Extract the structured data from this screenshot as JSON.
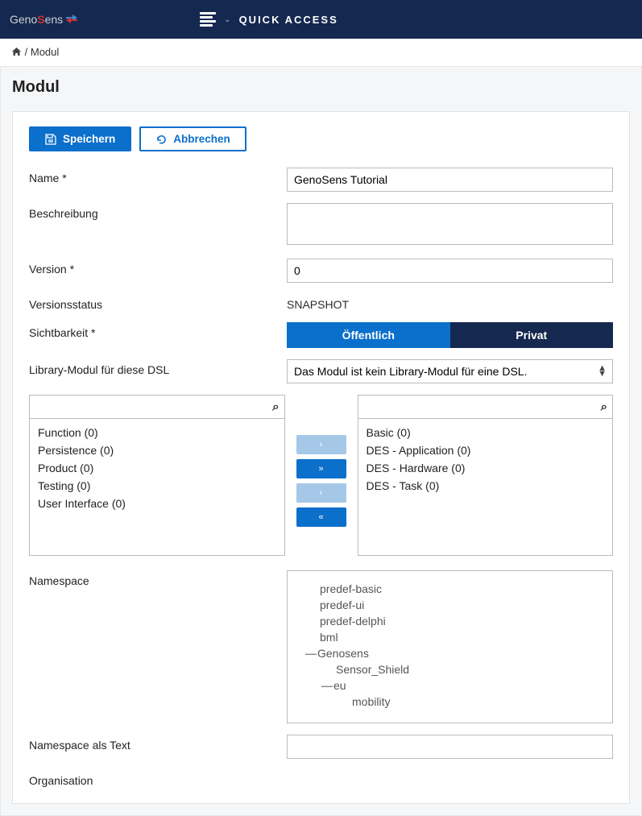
{
  "header": {
    "logo_part1": "Geno",
    "logo_part2": "S",
    "logo_part3": "ens",
    "quick_access": "QUICK ACCESS"
  },
  "breadcrumb": {
    "current": "Modul"
  },
  "page": {
    "title": "Modul"
  },
  "actions": {
    "save": "Speichern",
    "cancel": "Abbrechen"
  },
  "fields": {
    "name_label": "Name",
    "name_value": "GenoSens Tutorial",
    "description_label": "Beschreibung",
    "description_value": "",
    "version_label": "Version",
    "version_value": "0",
    "version_status_label": "Versionsstatus",
    "version_status_value": "SNAPSHOT",
    "visibility_label": "Sichtbarkeit",
    "visibility_public": "Öffentlich",
    "visibility_private": "Privat",
    "library_label": "Library-Modul für diese DSL",
    "library_value": "Das Modul ist kein Library-Modul für eine DSL.",
    "namespace_label": "Namespace",
    "namespace_text_label": "Namespace als Text",
    "namespace_text_value": "",
    "organisation_label": "Organisation"
  },
  "dual_list": {
    "left": [
      "Function (0)",
      "Persistence (0)",
      "Product (0)",
      "Testing (0)",
      "User Interface (0)"
    ],
    "right": [
      "Basic (0)",
      "DES - Application (0)",
      "DES - Hardware (0)",
      "DES - Task (0)"
    ]
  },
  "namespace_tree": [
    {
      "label": "predef-basic",
      "level": 1
    },
    {
      "label": "predef-ui",
      "level": 1
    },
    {
      "label": "predef-delphi",
      "level": 1
    },
    {
      "label": "bml",
      "level": 1
    },
    {
      "label": "Genosens",
      "level": 1,
      "expandable": true
    },
    {
      "label": "Sensor_Shield",
      "level": 2
    },
    {
      "label": "eu",
      "level": 2,
      "expandable": true
    },
    {
      "label": "mobility",
      "level": 3
    }
  ]
}
